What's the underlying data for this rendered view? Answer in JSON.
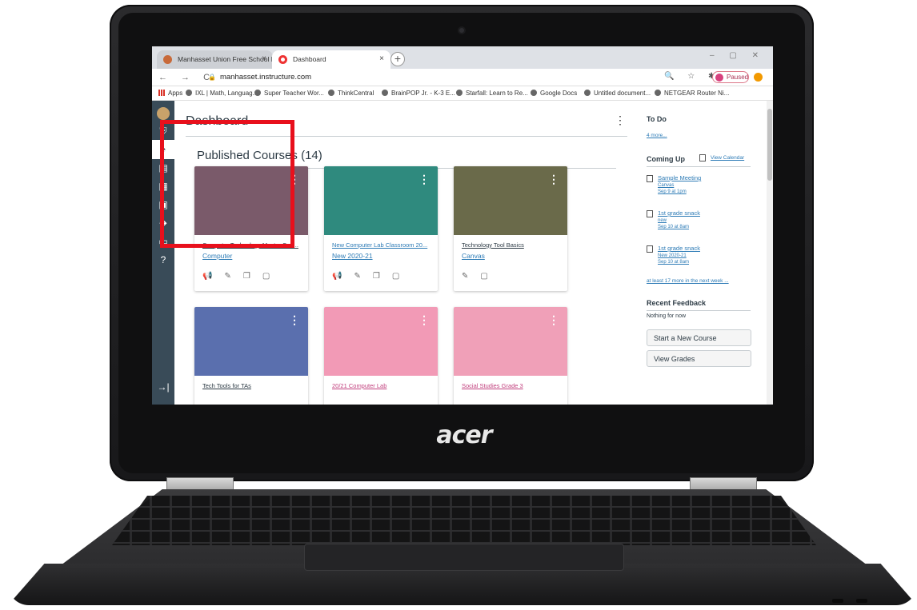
{
  "browser": {
    "tabs": [
      {
        "label": "Manhasset Union Free School Di..",
        "close": "×"
      },
      {
        "label": "Dashboard",
        "close": "×"
      }
    ],
    "new_tab": "+",
    "window_controls": "– ▢ ✕",
    "nav": "← → C",
    "url": "manhasset.instructure.com",
    "right_icons": "🔍 ☆ ✱",
    "profile_label": "Paused",
    "bookmarks": [
      "Apps",
      "IXL | Math, Languag...",
      "Super Teacher Wor...",
      "ThinkCentral",
      "BrainPOP Jr. - K-3 E...",
      "Starfall: Learn to Re...",
      "Google Docs",
      "Untitled document...",
      "NETGEAR Router Ni..."
    ]
  },
  "dashboard": {
    "title": "Dashboard",
    "section_title": "Published Courses (14)",
    "cards": [
      {
        "title": "Computer Technology Master Cou...",
        "subtitle": "Computer",
        "color": "#7a5a6a",
        "title_color": "#2d3b45"
      },
      {
        "title": "New Computer Lab Classroom 20...",
        "subtitle": "New 2020-21",
        "color": "#2f8a7e",
        "title_color": "#2d7bb6"
      },
      {
        "title": "Technology Tool Basics",
        "subtitle": "Canvas",
        "color": "#6a6a4a",
        "title_color": "#2d3b45"
      },
      {
        "title": "Tech Tools for TAs",
        "subtitle": "",
        "color": "#5a6fae",
        "title_color": "#2d3b45"
      },
      {
        "title": "20/21 Computer Lab",
        "subtitle": "",
        "color": "#f29ab6",
        "title_color": "#c2417e"
      },
      {
        "title": "Social Studies Grade 3",
        "subtitle": "",
        "color": "#f0a0b8",
        "title_color": "#c2417e"
      }
    ]
  },
  "sidebar": {
    "todo_title": "To Do",
    "todo_more": "4 more...",
    "coming_up_title": "Coming Up",
    "view_calendar": "View Calendar",
    "events": [
      {
        "title": "Sample Meeting",
        "course": "Canvas",
        "date": "Sep 9 at 1pm"
      },
      {
        "title": "1st grade snack",
        "course": "new",
        "date": "Sep 10 at 8am"
      },
      {
        "title": "1st grade snack",
        "course": "New 2020-21",
        "date": "Sep 10 at 8am"
      }
    ],
    "more_next_week": "at least 17 more in the next week ...",
    "recent_feedback_title": "Recent Feedback",
    "nothing_for_now": "Nothing for now",
    "start_course_btn": "Start a New Course",
    "view_grades_btn": "View Grades"
  },
  "laptop": {
    "brand": "acer"
  }
}
